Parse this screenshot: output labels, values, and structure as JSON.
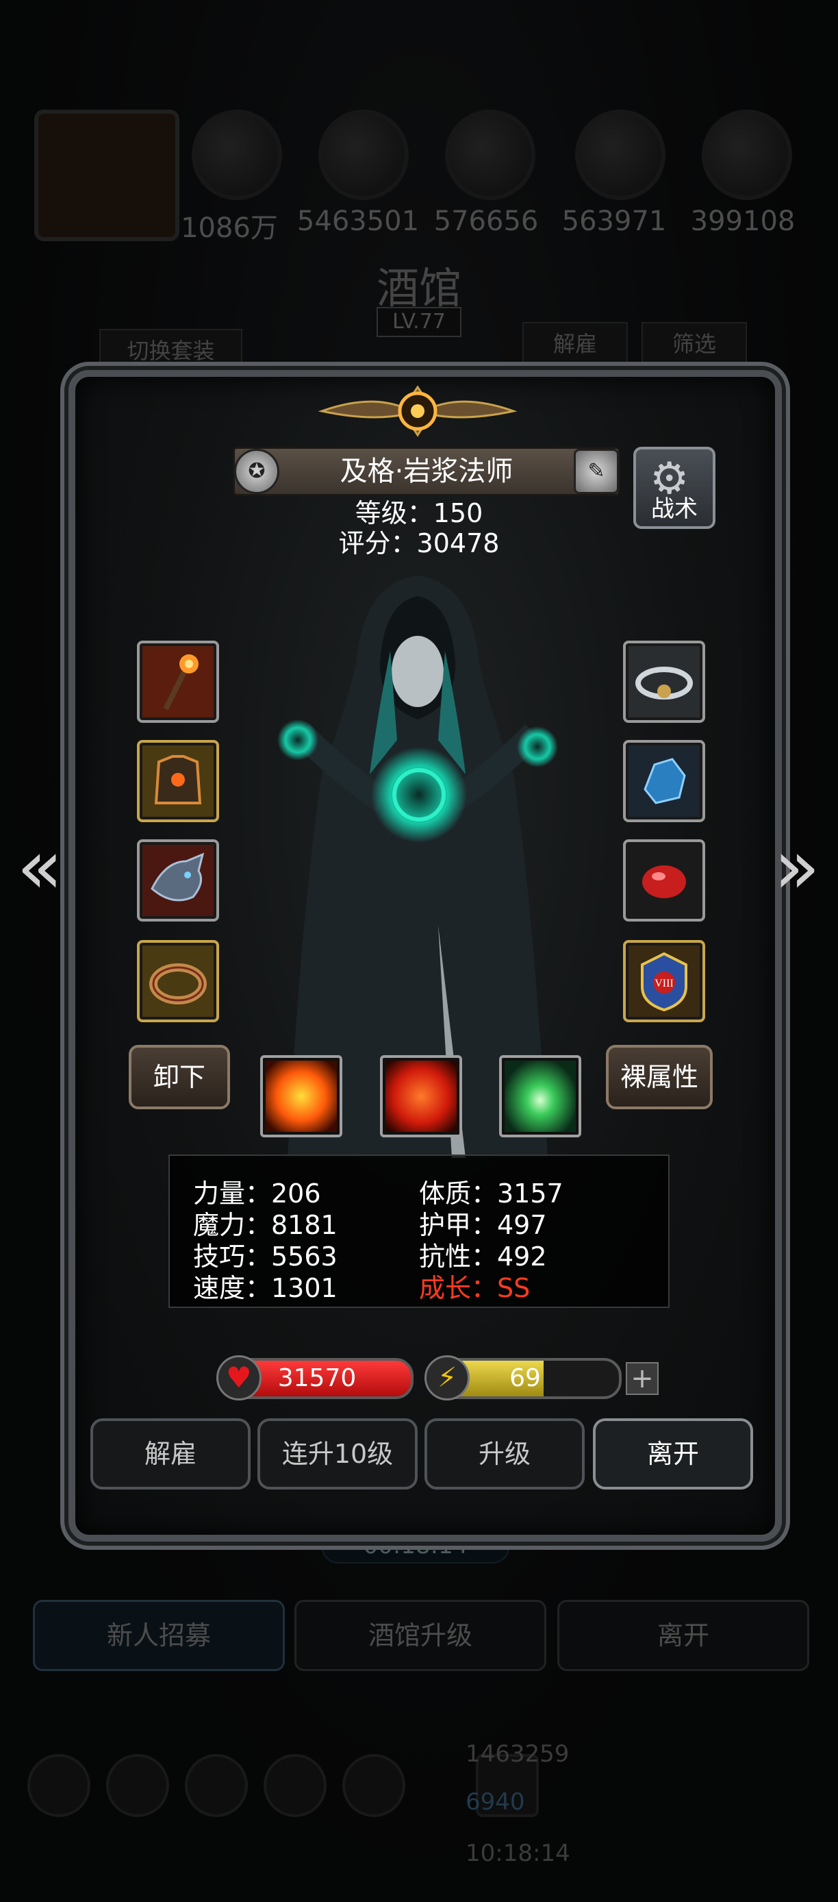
{
  "background": {
    "resources": [
      "1086万",
      "5463501",
      "576656",
      "563971",
      "399108"
    ],
    "title": "酒馆",
    "level": "LV.77",
    "switch_outfit": "切换套装",
    "dismiss": "解雇",
    "filter": "筛选",
    "timer": "00:18:14",
    "tabs": [
      "新人招募",
      "酒馆升级",
      "离开"
    ],
    "gold": "1463259",
    "gems": "6940",
    "clock": "10:18:14"
  },
  "hero": {
    "name": "及格·岩浆法师",
    "level": "等级：150",
    "score": "评分：30478",
    "tactics": "战术"
  },
  "equipment": {
    "left": [
      "staff",
      "armor",
      "dragon-helm",
      "ring"
    ],
    "right": [
      "bracelet",
      "blue-crystal",
      "red-gem",
      "emblem"
    ]
  },
  "buttons": {
    "unequip": "卸下",
    "naked_attr": "裸属性",
    "dismiss": "解雇",
    "level10": "连升10级",
    "upgrade": "升级",
    "leave": "离开"
  },
  "stats": {
    "strength": "力量：206",
    "magic": "魔力：8181",
    "skill": "技巧：5563",
    "speed": "速度：1301",
    "constitution": "体质：3157",
    "armor": "护甲：497",
    "resistance": "抗性：492",
    "growth": "成长：SS"
  },
  "bars": {
    "hp": "31570",
    "energy": "69",
    "energy_fraction": 0.6
  },
  "colors": {
    "growth": "#ff3b1f",
    "hp": "#d11a1a",
    "energy": "#d4c12c"
  }
}
